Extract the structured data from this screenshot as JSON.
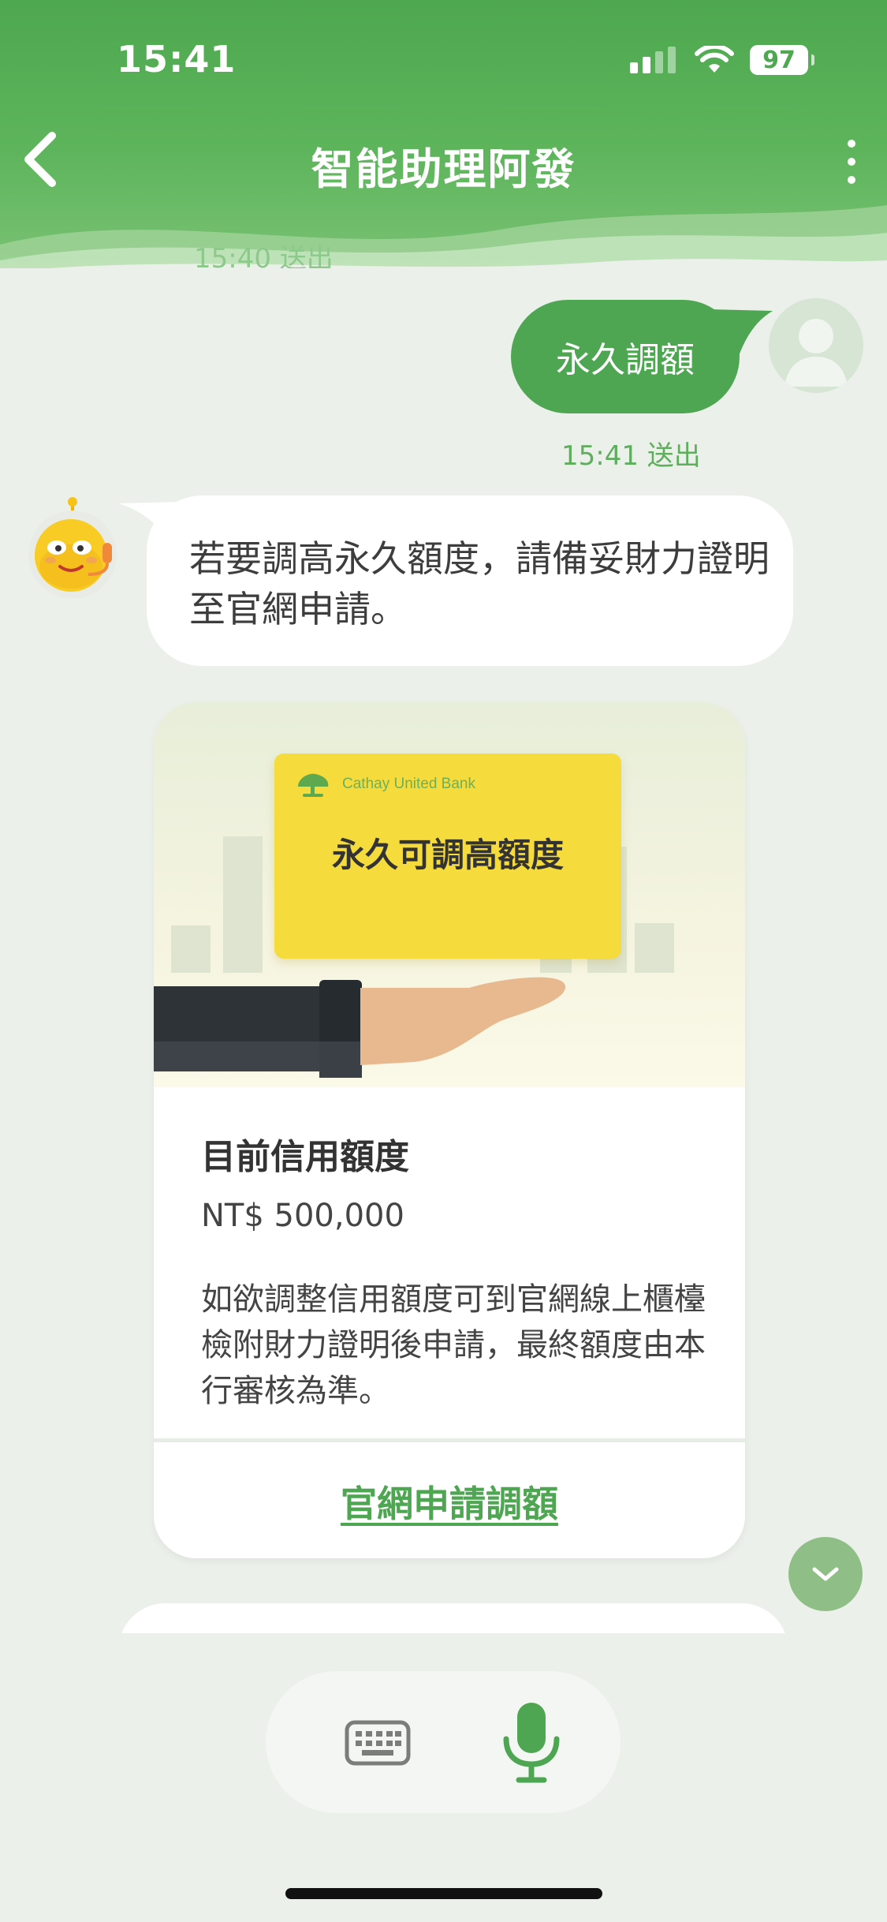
{
  "status_bar": {
    "time": "15:41",
    "battery": "97"
  },
  "header": {
    "title": "智能助理阿發"
  },
  "timestamps": {
    "previous": "15:40 送出",
    "user": "15:41 送出"
  },
  "messages": {
    "user_text": "永久調額",
    "bot_text": "若要調高永久額度，請備妥財力證明至官網申請。"
  },
  "card": {
    "illustration": {
      "bank_name": "Cathay United Bank",
      "card_title": "永久可調高額度"
    },
    "heading": "目前信用額度",
    "amount": "NT$ 500,000",
    "description": "如欲調整信用額度可到官網線上櫃檯檢附財力證明後申請，最終額度由本行審核為準。",
    "link_label": "官網申請調額"
  },
  "colors": {
    "brand_green": "#4fa652",
    "card_yellow": "#f6db3c"
  },
  "icons": {
    "back": "chevron-left-icon",
    "more": "more-vertical-icon",
    "scroll_down": "chevron-down-icon",
    "keyboard": "keyboard-icon",
    "mic": "microphone-icon"
  }
}
